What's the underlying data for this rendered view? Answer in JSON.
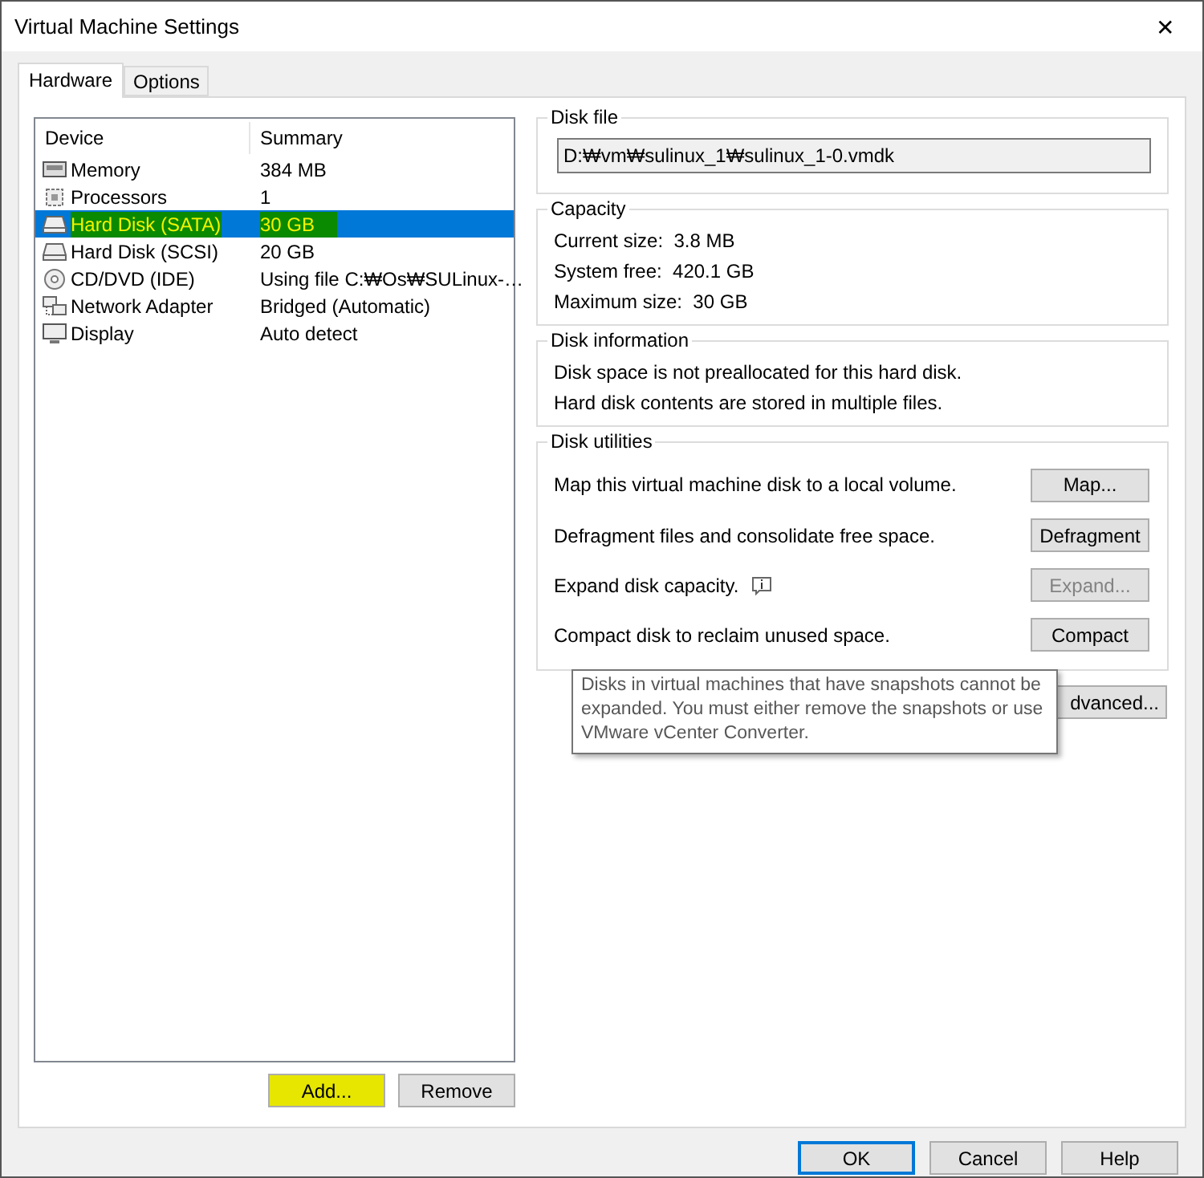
{
  "window": {
    "title": "Virtual Machine Settings",
    "close": "✕"
  },
  "tabs": [
    {
      "label": "Hardware",
      "selected": true
    },
    {
      "label": "Options",
      "selected": false
    }
  ],
  "device_list": {
    "columns": [
      "Device",
      "Summary"
    ],
    "rows": [
      {
        "kind": "memory",
        "device": "Memory",
        "summary": "384 MB",
        "selected": false,
        "highlighted": false
      },
      {
        "kind": "processor",
        "device": "Processors",
        "summary": "1",
        "selected": false,
        "highlighted": false
      },
      {
        "kind": "disk",
        "device": "Hard Disk (SATA)",
        "summary": "30 GB",
        "selected": true,
        "highlighted": true
      },
      {
        "kind": "disk",
        "device": "Hard Disk (SCSI)",
        "summary": "20 GB",
        "selected": false,
        "highlighted": false
      },
      {
        "kind": "cd",
        "device": "CD/DVD (IDE)",
        "summary": "Using file C:₩Os₩SULinux-…",
        "selected": false,
        "highlighted": false
      },
      {
        "kind": "network",
        "device": "Network Adapter",
        "summary": "Bridged (Automatic)",
        "selected": false,
        "highlighted": false
      },
      {
        "kind": "display",
        "device": "Display",
        "summary": "Auto detect",
        "selected": false,
        "highlighted": false
      }
    ]
  },
  "list_buttons": [
    {
      "label": "Add...",
      "highlighted": true
    },
    {
      "label": "Remove",
      "highlighted": false
    }
  ],
  "disk_file": {
    "title": "Disk file",
    "value": "D:₩vm₩sulinux_1₩sulinux_1-0.vmdk"
  },
  "capacity": {
    "title": "Capacity",
    "lines": [
      "Current size:  3.8 MB",
      "System free:  420.1 GB",
      "Maximum size:  30 GB"
    ]
  },
  "disk_information": {
    "title": "Disk information",
    "lines": [
      "Disk space is not preallocated for this hard disk.",
      "Hard disk contents are stored in multiple files."
    ]
  },
  "disk_utilities": {
    "title": "Disk utilities",
    "rows": [
      {
        "text": "Map this virtual machine disk to a local volume.",
        "button": "Map...",
        "disabled": false,
        "info": false
      },
      {
        "text": "Defragment files and consolidate free space.",
        "button": "Defragment",
        "disabled": false,
        "info": false
      },
      {
        "text": "Expand disk capacity.",
        "button": "Expand...",
        "disabled": true,
        "info": true
      },
      {
        "text": "Compact disk to reclaim unused space.",
        "button": "Compact",
        "disabled": false,
        "info": false
      }
    ]
  },
  "advanced_button": "dvanced...",
  "tooltip": "Disks in virtual machines that have snapshots cannot be expanded. You must either remove the snapshots or use VMware vCenter Converter.",
  "footer_buttons": [
    {
      "label": "OK",
      "default": true
    },
    {
      "label": "Cancel",
      "default": false
    },
    {
      "label": "Help",
      "default": false
    }
  ]
}
